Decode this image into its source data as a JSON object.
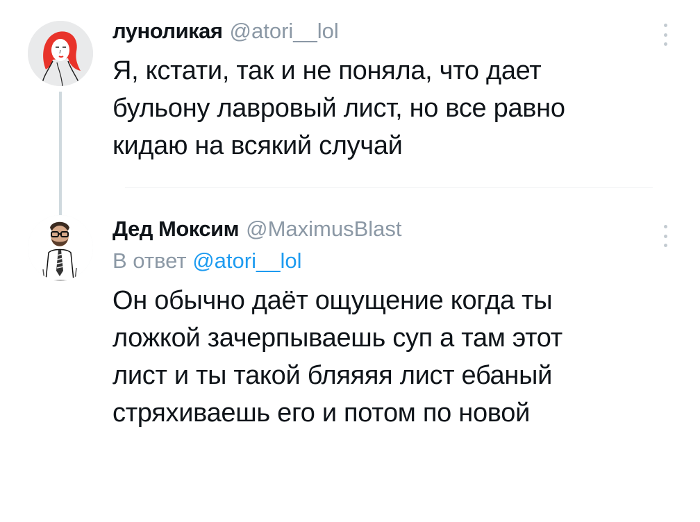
{
  "tweets": [
    {
      "author": {
        "name": "луноликая",
        "handle": "@atori__lol",
        "avatar_icon": "red-haired-woman-avatar"
      },
      "text_lines": [
        "Я, кстати, так и не поняла, что дает",
        "бульону лавровый лист, но все равно",
        "кидаю на всякий случай"
      ]
    },
    {
      "author": {
        "name": "Дед Моксим",
        "handle": "@MaximusBlast",
        "avatar_icon": "man-in-suit-avatar"
      },
      "reply_to_prefix": "В ответ",
      "reply_to_handle": "@atori__lol",
      "text_lines": [
        "Он обычно даёт ощущение когда ты",
        "ложкой зачерпываешь суп а там этот",
        "лист и ты такой бляяяя лист ебаный",
        "стряхиваешь его и потом по новой"
      ]
    }
  ],
  "colors": {
    "text": "#0f1419",
    "secondary": "#8b98a5",
    "link": "#1d9bf0",
    "thread_line": "#cfd9de"
  }
}
